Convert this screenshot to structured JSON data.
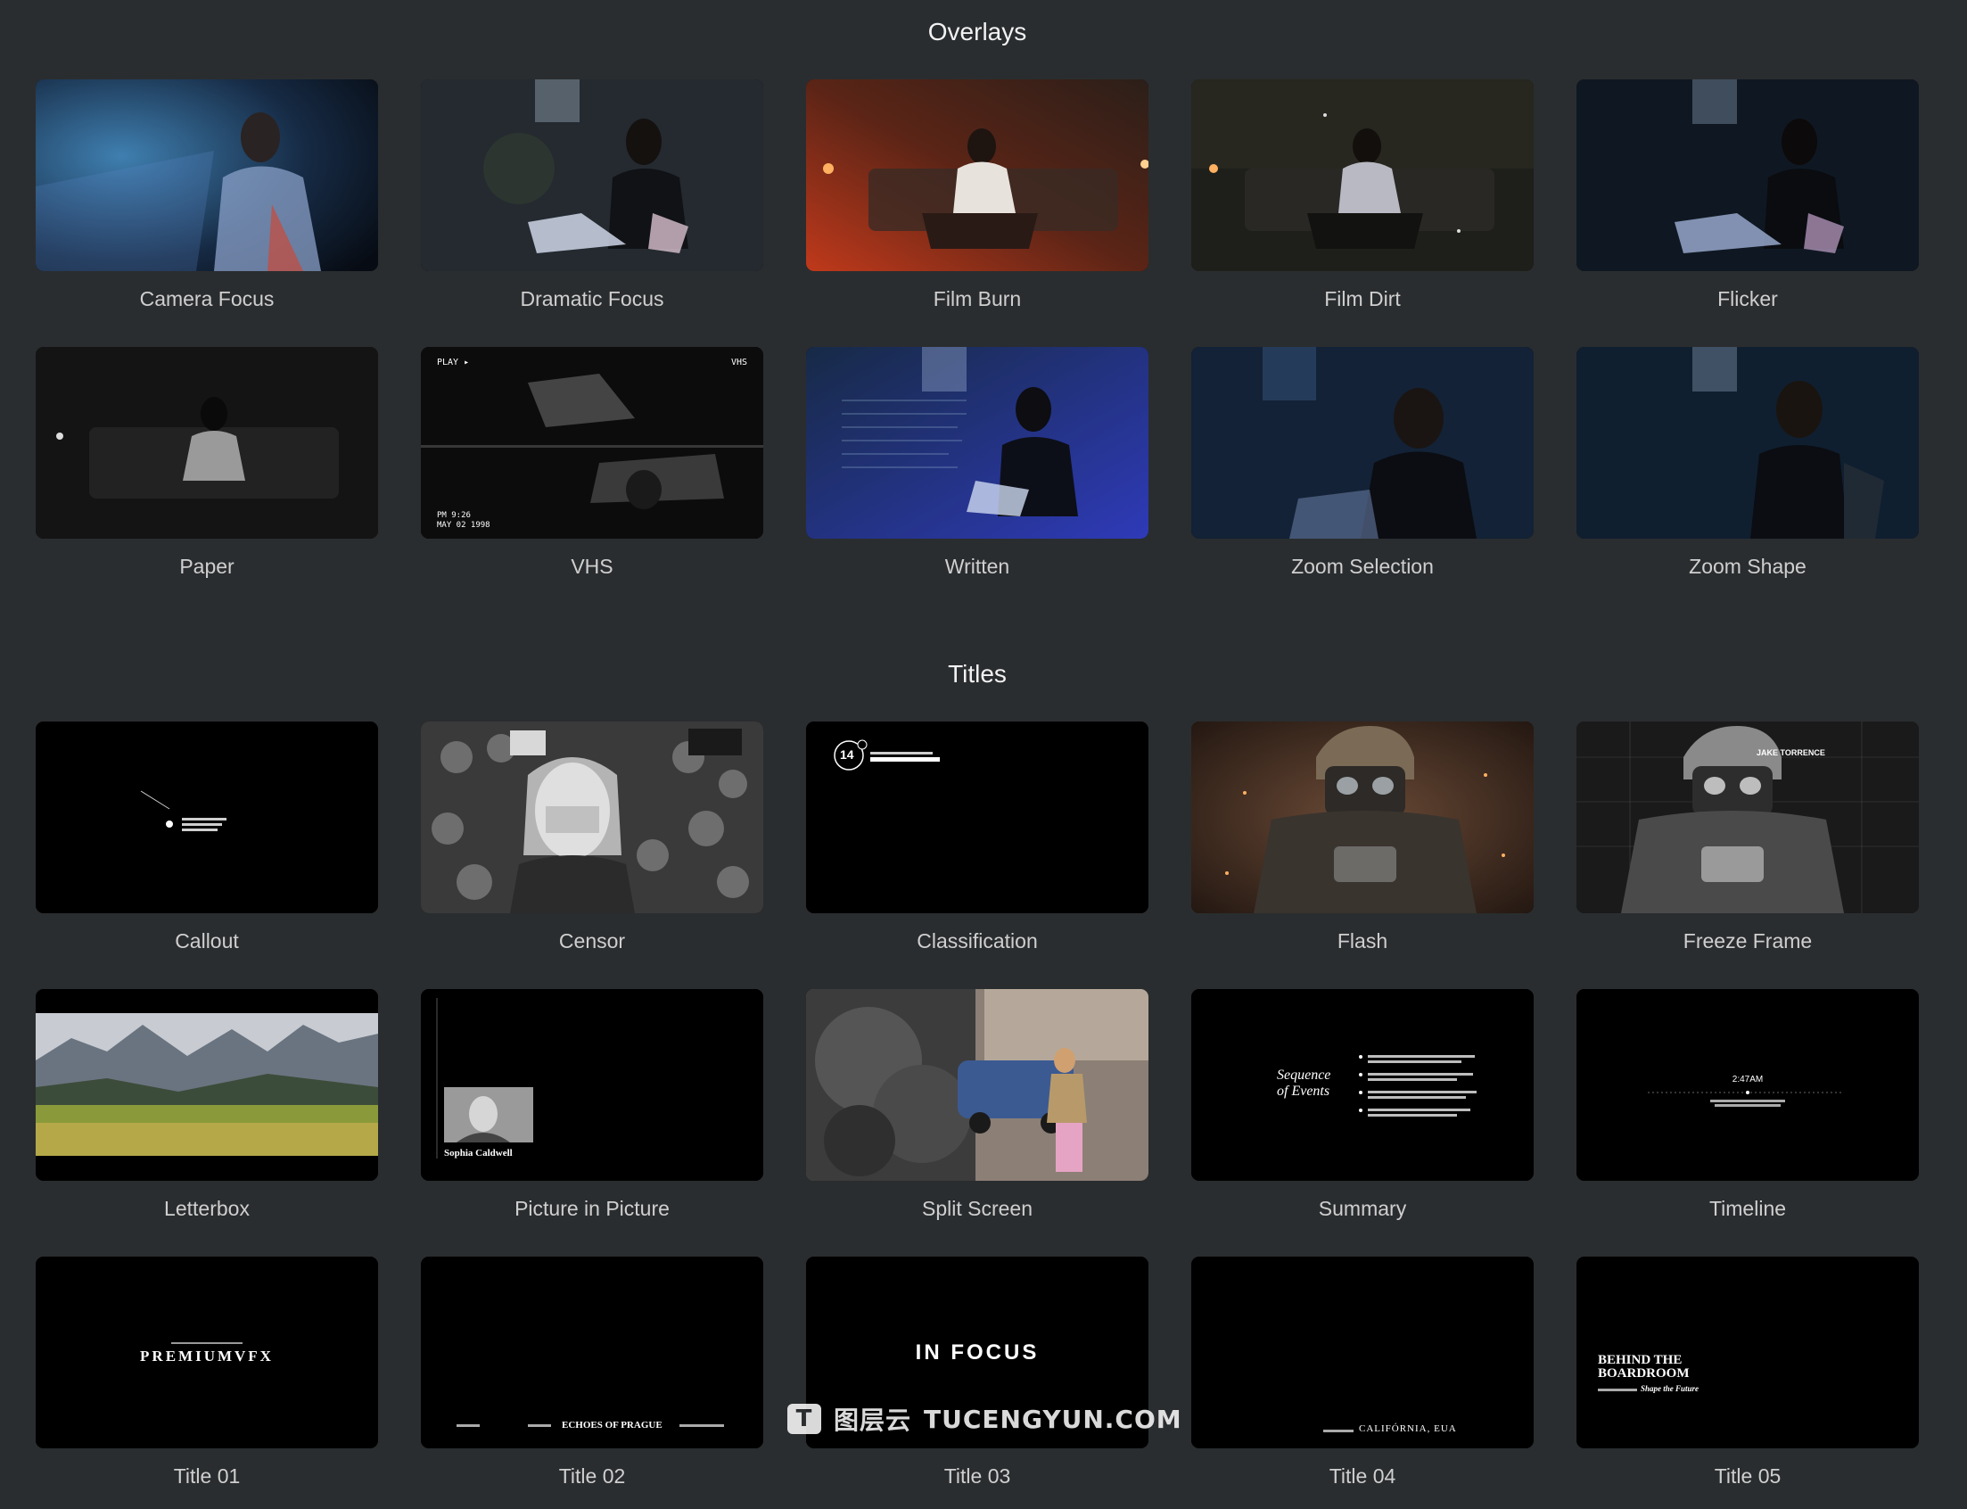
{
  "sections": {
    "overlays": {
      "title": "Overlays"
    },
    "titles": {
      "title": "Titles"
    }
  },
  "overlays": [
    {
      "label": "Camera Focus"
    },
    {
      "label": "Dramatic Focus"
    },
    {
      "label": "Film Burn"
    },
    {
      "label": "Film Dirt"
    },
    {
      "label": "Flicker"
    },
    {
      "label": "Paper"
    },
    {
      "label": "VHS"
    },
    {
      "label": "Written"
    },
    {
      "label": "Zoom Selection"
    },
    {
      "label": "Zoom Shape"
    }
  ],
  "titles": [
    {
      "label": "Callout"
    },
    {
      "label": "Censor"
    },
    {
      "label": "Classification"
    },
    {
      "label": "Flash"
    },
    {
      "label": "Freeze Frame"
    },
    {
      "label": "Letterbox"
    },
    {
      "label": "Picture in Picture"
    },
    {
      "label": "Split Screen"
    },
    {
      "label": "Summary"
    },
    {
      "label": "Timeline"
    },
    {
      "label": "Title 01"
    },
    {
      "label": "Title 02"
    },
    {
      "label": "Title 03"
    },
    {
      "label": "Title 04"
    },
    {
      "label": "Title 05"
    }
  ],
  "thumb_text": {
    "vhs_play": "PLAY ▸",
    "vhs_mode": "VHS",
    "vhs_time": "PM 9:26",
    "vhs_date": "MAY 02 1998",
    "classification_rating": "14",
    "pip_name": "Sophia Caldwell",
    "summary_heading_1": "Sequence",
    "summary_heading_2": "of Events",
    "timeline_time": "2:47AM",
    "freeze_name": "JAKE TORRENCE",
    "title01_main": "PREMIUMVFX",
    "title02_main": "ECHOES OF PRAGUE",
    "title03_main": "IN FOCUS",
    "title04_main": "CALIFÓRNIA, EUA",
    "title05_line1": "BEHIND THE",
    "title05_line2": "BOARDROOM",
    "title05_tagline": "Shape the Future"
  },
  "watermark": {
    "logo": "T",
    "cn_text": "图层云",
    "site": "TUCENGYUN.COM"
  }
}
